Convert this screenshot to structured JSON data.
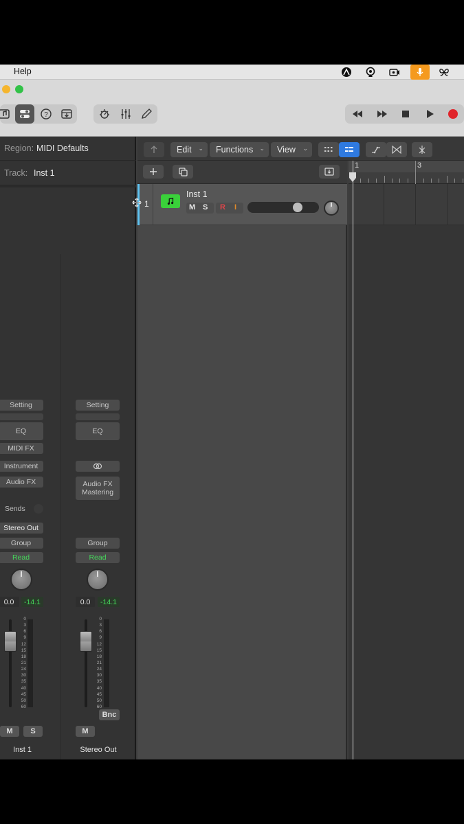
{
  "menubar": {
    "help": "Help",
    "icons": [
      "menu-extra-a-icon",
      "airplay-icon",
      "camera-icon",
      "microphone-icon",
      "butterfly-icon"
    ]
  },
  "toolbar": {
    "buttons": [
      "library-icon",
      "smart-controls-icon",
      "help-icon",
      "download-icon",
      "tuner-icon",
      "mixer-icon",
      "pencil-icon"
    ],
    "transport": [
      "rewind-icon",
      "fast-forward-icon",
      "stop-icon",
      "play-icon",
      "record-icon"
    ],
    "record_color": "#e0252b"
  },
  "inspector": {
    "region_label": "Region:",
    "region_value": "MIDI Defaults",
    "track_label": "Track:",
    "track_value": "Inst 1",
    "strip1": {
      "setting": "Setting",
      "eq": "EQ",
      "midi_fx": "MIDI FX",
      "instrument": "Instrument",
      "audio_fx": "Audio FX",
      "sends": "Sends",
      "output": "Stereo Out",
      "group": "Group",
      "automation": "Read",
      "volume": "0.0",
      "peak": "-14.1",
      "mute": "M",
      "solo": "S",
      "name": "Inst 1"
    },
    "strip2": {
      "setting": "Setting",
      "eq": "EQ",
      "audio_fx_line1": "Audio FX",
      "audio_fx_line2": "Mastering",
      "group": "Group",
      "automation": "Read",
      "volume": "0.0",
      "peak": "-14.1",
      "bounce": "Bnc",
      "mute": "M",
      "name": "Stereo Out"
    },
    "scale": [
      "0",
      "3",
      "6",
      "9",
      "12",
      "15",
      "18",
      "21",
      "24",
      "30",
      "35",
      "40",
      "45",
      "50",
      "60"
    ]
  },
  "tracks_header": {
    "edit": "Edit",
    "functions": "Functions",
    "view": "View"
  },
  "track": {
    "number": "1",
    "name": "Inst 1",
    "mute": "M",
    "solo": "S",
    "record": "R",
    "input": "I",
    "color": "#3ad13a"
  },
  "ruler": {
    "bars": [
      "1",
      "3"
    ]
  }
}
